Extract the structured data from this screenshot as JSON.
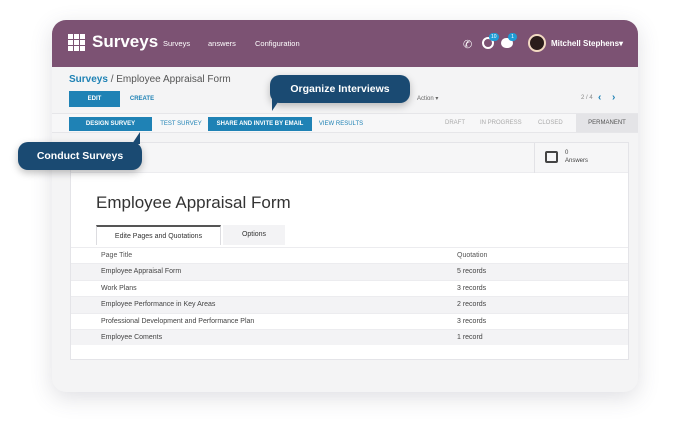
{
  "topbar": {
    "app_title": "Surveys",
    "nav": [
      "Surveys",
      "answers",
      "Configuration"
    ],
    "activity_badge": "10",
    "chat_badge": "1",
    "user_name": "Mitchell Stephens"
  },
  "breadcrumb": {
    "root": "Surveys",
    "separator": " / ",
    "current": "Employee Appraisal Form"
  },
  "control": {
    "edit_label": "EDIT",
    "create_label": "CREATE",
    "action_label": "Action",
    "pager": "2 / 4"
  },
  "statusbar": {
    "buttons": [
      "DESIGN SURVEY",
      "TEST SURVEY",
      "SHARE AND INVITE BY EMAIL",
      "VIEW RESULTS"
    ],
    "stages": [
      "DRAFT",
      "IN PROGRESS",
      "CLOSED",
      "PERMANENT"
    ]
  },
  "sheet": {
    "answers_count": "0",
    "answers_label": "Answers",
    "title": "Employee Appraisal Form",
    "tabs": [
      "Edite Pages and Quotations",
      "Options"
    ],
    "table": {
      "headers": [
        "Page Title",
        "Quotation"
      ],
      "rows": [
        {
          "title": "Employee Appraisal Form",
          "quotation": "5 records"
        },
        {
          "title": "Work Plans",
          "quotation": "3 records"
        },
        {
          "title": "Employee Performance in Key Areas",
          "quotation": "2 records"
        },
        {
          "title": "Professional Development and Performance Plan",
          "quotation": "3 records"
        },
        {
          "title": "Employee Coments",
          "quotation": "1 record"
        }
      ]
    }
  },
  "callouts": {
    "organize": "Organize Interviews",
    "conduct": "Conduct Surveys"
  },
  "colors": {
    "topbar": "#7c5273",
    "primary": "#1f82b5",
    "callout": "#1a4a72"
  }
}
